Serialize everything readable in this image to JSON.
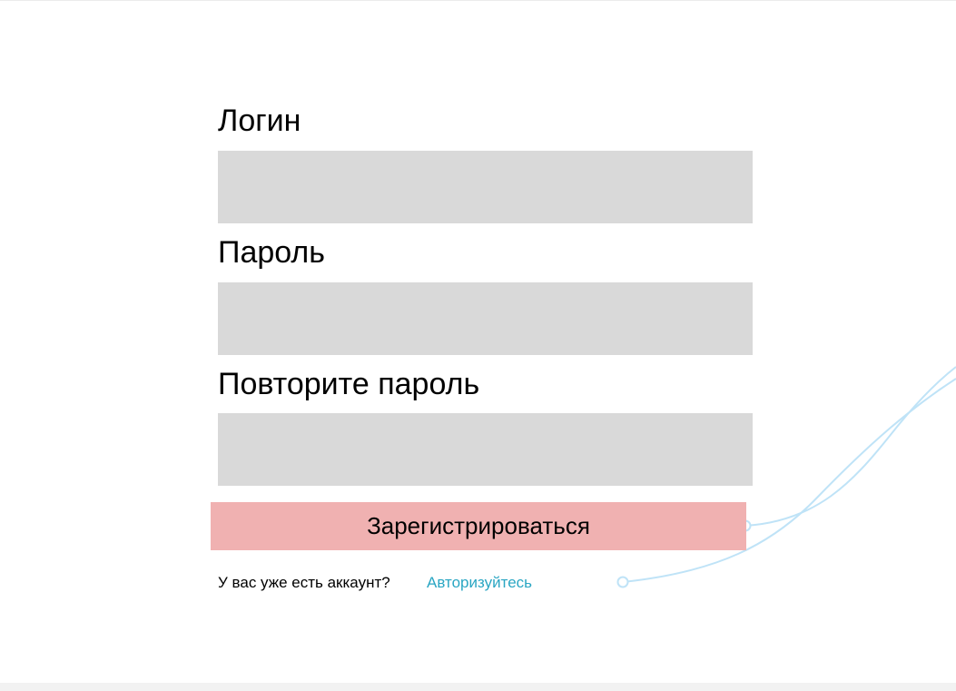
{
  "form": {
    "login_label": "Логин",
    "login_value": "",
    "password_label": "Пароль",
    "password_value": "",
    "repeat_password_label": "Повторите пароль",
    "repeat_password_value": "",
    "register_button_label": "Зарегистрироваться"
  },
  "footer": {
    "account_question": "У вас уже есть аккаунт?",
    "login_link": "Авторизуйтесь"
  },
  "colors": {
    "input_background": "#d9d9d9",
    "button_background": "#f0b1b1",
    "link": "#2aa6c3",
    "decor_line": "#bfe3f7"
  }
}
